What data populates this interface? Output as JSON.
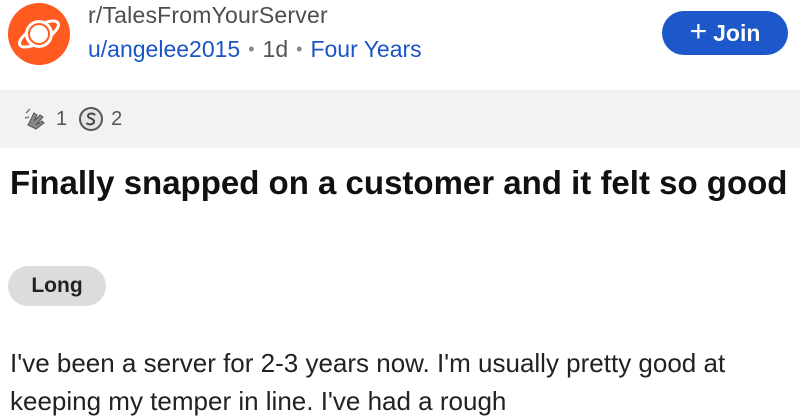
{
  "header": {
    "subreddit": "r/TalesFromYourServer",
    "author": "u/angelee2015",
    "age": "1d",
    "flair_user": "Four Years",
    "separator": "•",
    "join_label": "Join",
    "join_icon": "plus-icon"
  },
  "awards": [
    {
      "icon": "award-pray-icon",
      "count": "1"
    },
    {
      "icon": "award-silver-icon",
      "count": "2"
    }
  ],
  "post": {
    "title": "Finally snapped on a customer and it felt so good",
    "flair": "Long",
    "body": "I've been a server for 2-3 years now. I'm usually pretty good at keeping my temper in line. I've had a rough"
  },
  "colors": {
    "accent": "#1c58c9",
    "subreddit_icon": "#ff5a1f"
  }
}
